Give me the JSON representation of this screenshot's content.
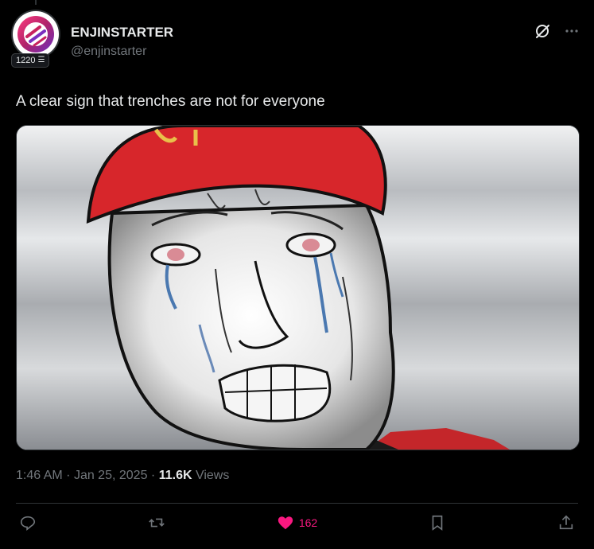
{
  "author": {
    "name": "ENJINSTARTER",
    "handle": "@enjinstarter",
    "badge_count": "1220"
  },
  "tweet": {
    "text": "A clear sign that trenches are not for everyone",
    "time": "1:46 AM",
    "date": "Jan 25, 2025",
    "views_count": "11.6K",
    "views_label": "Views"
  },
  "actions": {
    "like_count": "162"
  },
  "colors": {
    "background": "#000000",
    "muted": "#71767b",
    "like": "#f91880",
    "brand": "#c8235f"
  },
  "icons": [
    "grok-icon",
    "more-icon",
    "reply-icon",
    "retweet-icon",
    "like-icon",
    "bookmark-icon",
    "share-icon"
  ]
}
